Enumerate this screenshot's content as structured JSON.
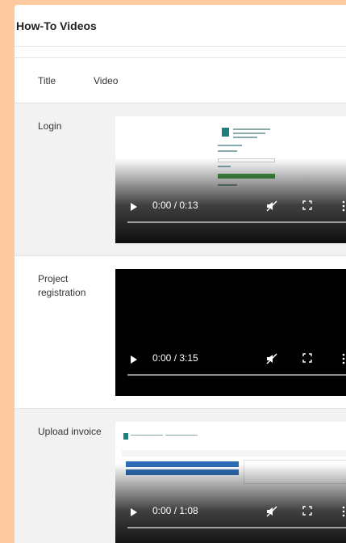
{
  "panel": {
    "title": "How-To Videos"
  },
  "table": {
    "headers": {
      "title": "Title",
      "video": "Video"
    },
    "rows": [
      {
        "title": "Login",
        "time": "0:00 / 0:13"
      },
      {
        "title": "Project registration",
        "time": "0:00 / 3:15"
      },
      {
        "title": "Upload invoice",
        "time": "0:00 / 1:08"
      }
    ]
  },
  "colors": {
    "page_background": "#fdcaa0",
    "panel_background": "#ffffff",
    "row_alt_background": "#f2f2f2",
    "video_background": "#000000"
  },
  "icons": {
    "play": "play-icon",
    "mute": "muted-speaker-icon",
    "fullscreen": "fullscreen-icon",
    "more": "more-options-icon"
  }
}
